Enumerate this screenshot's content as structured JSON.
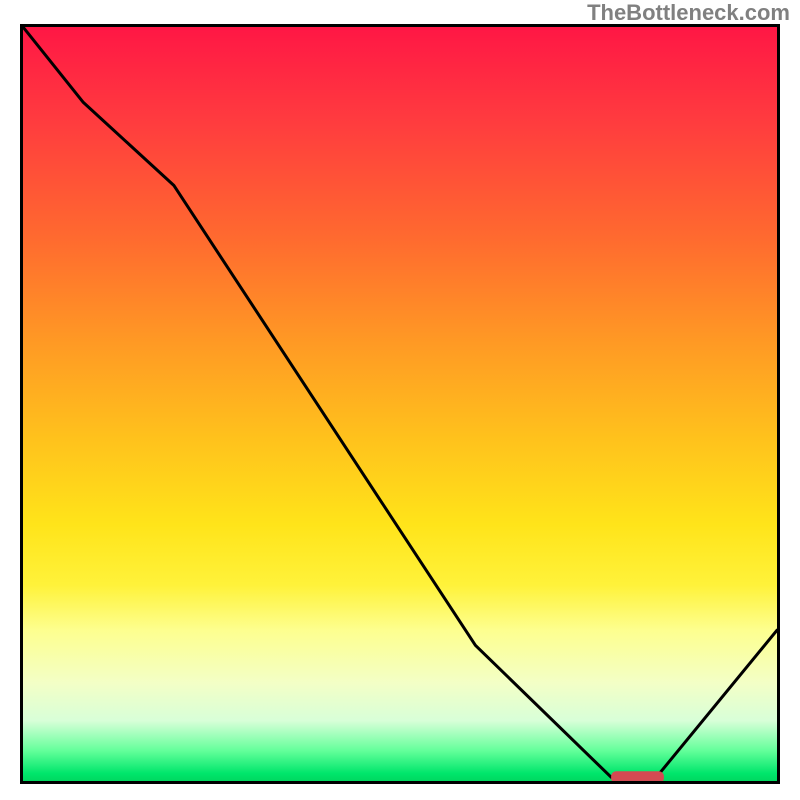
{
  "watermark": "TheBottleneck.com",
  "colors": {
    "border": "#000000",
    "watermark": "#808080",
    "curve_stroke": "#000000",
    "marker_fill": "#d44a52",
    "gradient_top": "#ff1745",
    "gradient_bottom": "#00d860"
  },
  "chart_data": {
    "type": "line",
    "title": "",
    "xlabel": "",
    "ylabel": "",
    "xlim": [
      0,
      100
    ],
    "ylim": [
      0,
      100
    ],
    "series": [
      {
        "name": "bottleneck-curve",
        "x": [
          0,
          8,
          20,
          60,
          78,
          84,
          100
        ],
        "y": [
          100,
          90,
          79,
          18,
          0.5,
          0.5,
          20
        ]
      }
    ],
    "marker": {
      "x_start": 78,
      "x_end": 85,
      "y": 0.5
    },
    "axes_visible": false,
    "grid": false
  }
}
